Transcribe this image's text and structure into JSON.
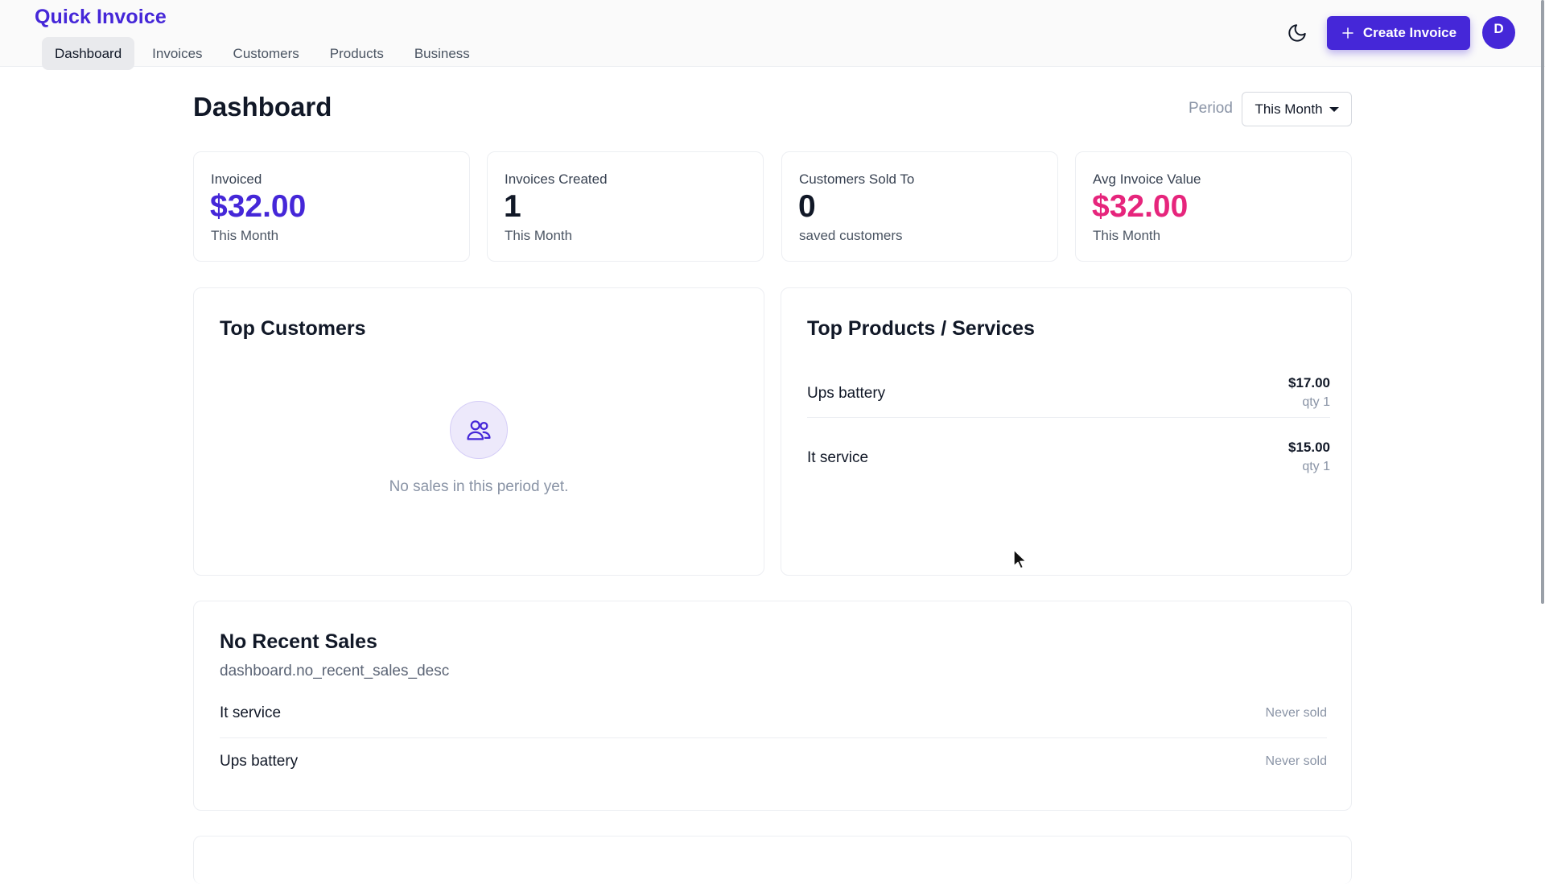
{
  "app": {
    "brand": "Quick Invoice"
  },
  "nav": {
    "items": [
      {
        "label": "Dashboard",
        "active": true
      },
      {
        "label": "Invoices",
        "active": false
      },
      {
        "label": "Customers",
        "active": false
      },
      {
        "label": "Products",
        "active": false
      },
      {
        "label": "Business",
        "active": false
      }
    ]
  },
  "header": {
    "theme_icon": "moon-icon",
    "create_label": "Create Invoice",
    "create_icon": "plus-icon",
    "avatar_initial": "D"
  },
  "page": {
    "title": "Dashboard",
    "period_label": "Period",
    "period_value": "This Month"
  },
  "stats": [
    {
      "label": "Invoiced",
      "value": "$32.00",
      "sub": "This Month",
      "color": "#4527d8"
    },
    {
      "label": "Invoices Created",
      "value": "1",
      "sub": "This Month",
      "color": "#111827"
    },
    {
      "label": "Customers Sold To",
      "value": "0",
      "sub": "saved customers",
      "color": "#111827"
    },
    {
      "label": "Avg Invoice Value",
      "value": "$32.00",
      "sub": "This Month",
      "color": "#e6257c"
    }
  ],
  "top_customers": {
    "title": "Top Customers",
    "empty_icon": "users-icon",
    "empty_text": "No sales in this period yet."
  },
  "top_products": {
    "title": "Top Products / Services",
    "items": [
      {
        "name": "Ups battery",
        "amount": "$17.00",
        "qty": "qty 1"
      },
      {
        "name": "It service",
        "amount": "$15.00",
        "qty": "qty 1"
      }
    ]
  },
  "recent_sales": {
    "title": "No Recent Sales",
    "description": "dashboard.no_recent_sales_desc",
    "items": [
      {
        "name": "It service",
        "status": "Never sold"
      },
      {
        "name": "Ups battery",
        "status": "Never sold"
      }
    ]
  },
  "colors": {
    "accent": "#4527d8",
    "pink": "#e6257c",
    "muted": "#8a94a6"
  }
}
